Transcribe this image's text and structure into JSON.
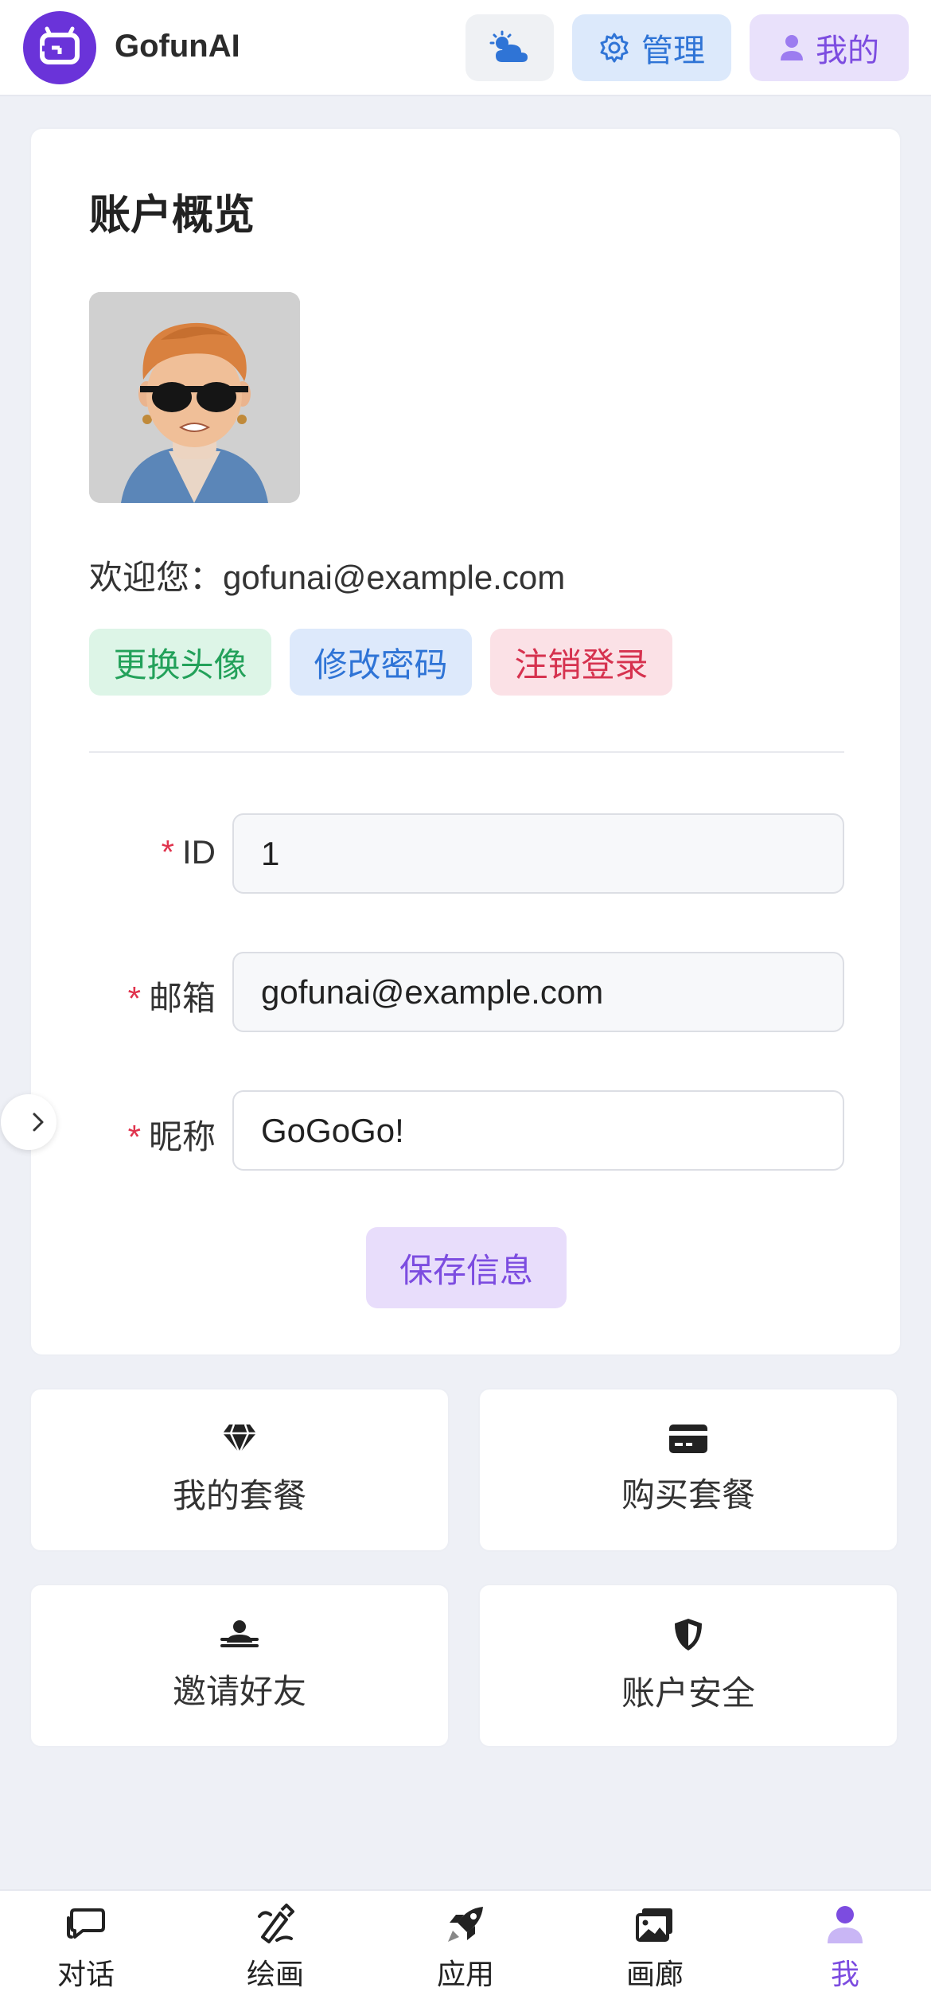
{
  "header": {
    "app_name": "GofunAI",
    "admin_label": "管理",
    "mine_label": "我的"
  },
  "account": {
    "title": "账户概览",
    "welcome": "欢迎您：gofunai@example.com",
    "actions": {
      "change_avatar": "更换头像",
      "change_password": "修改密码",
      "logout": "注销登录"
    },
    "form": {
      "required_mark": "*",
      "id_label": "ID",
      "id_value": "1",
      "email_label": "邮箱",
      "email_value": "gofunai@example.com",
      "nickname_label": "昵称",
      "nickname_value": "GoGoGo!"
    },
    "save_label": "保存信息"
  },
  "tiles": [
    {
      "label": "我的套餐",
      "icon": "diamond-icon"
    },
    {
      "label": "购买套餐",
      "icon": "credit-card-icon"
    },
    {
      "label": "邀请好友",
      "icon": "people-icon"
    },
    {
      "label": "账户安全",
      "icon": "shield-icon"
    }
  ],
  "bottom_nav": [
    {
      "label": "对话",
      "icon": "chat-icon"
    },
    {
      "label": "绘画",
      "icon": "paint-icon"
    },
    {
      "label": "应用",
      "icon": "rocket-icon"
    },
    {
      "label": "画廊",
      "icon": "gallery-icon"
    },
    {
      "label": "我",
      "icon": "user-icon",
      "active": true
    }
  ],
  "colors": {
    "accent": "#7c4ce0",
    "blue": "#2f74d6",
    "green": "#23a15a",
    "red": "#d6324f"
  }
}
